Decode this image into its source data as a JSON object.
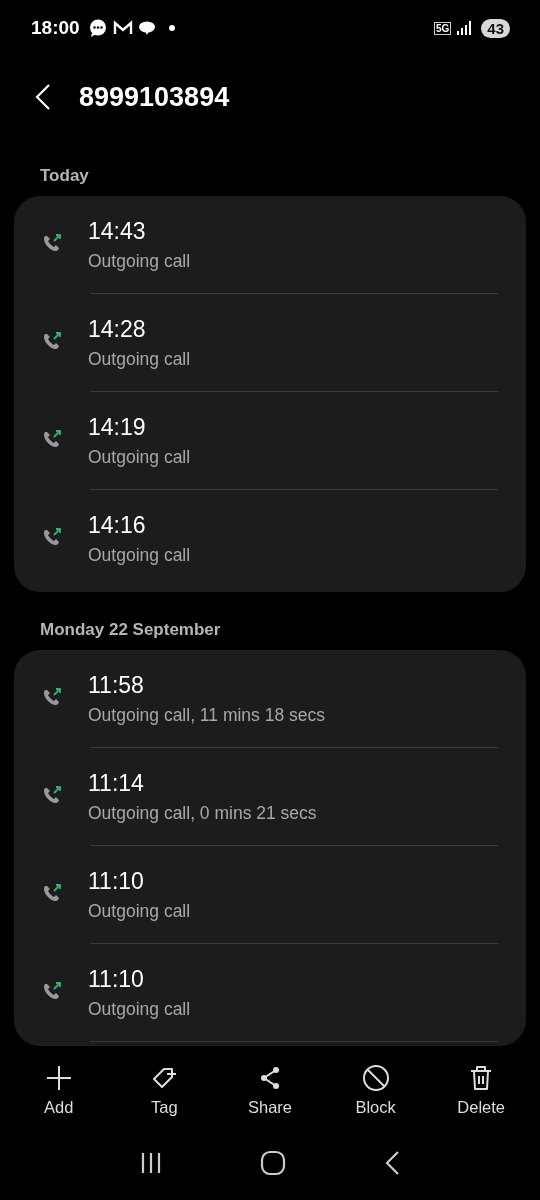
{
  "status_bar": {
    "time": "18:00",
    "network": "5G",
    "battery": "43"
  },
  "header": {
    "title": "8999103894"
  },
  "groups": [
    {
      "label": "Today",
      "continues": false,
      "calls": [
        {
          "time": "14:43",
          "detail": "Outgoing call",
          "kind": "outgoing"
        },
        {
          "time": "14:28",
          "detail": "Outgoing call",
          "kind": "outgoing"
        },
        {
          "time": "14:19",
          "detail": "Outgoing call",
          "kind": "outgoing"
        },
        {
          "time": "14:16",
          "detail": "Outgoing call",
          "kind": "outgoing"
        }
      ]
    },
    {
      "label": "Monday 22 September",
      "continues": true,
      "calls": [
        {
          "time": "11:58",
          "detail": "Outgoing call, 11 mins 18 secs",
          "kind": "outgoing"
        },
        {
          "time": "11:14",
          "detail": "Outgoing call, 0 mins 21 secs",
          "kind": "outgoing"
        },
        {
          "time": "11:10",
          "detail": "Outgoing call",
          "kind": "outgoing"
        },
        {
          "time": "11:10",
          "detail": "Outgoing call",
          "kind": "outgoing"
        }
      ]
    }
  ],
  "toolbar": [
    {
      "label": "Add",
      "kind": "add"
    },
    {
      "label": "Tag",
      "kind": "tag"
    },
    {
      "label": "Share",
      "kind": "share"
    },
    {
      "label": "Block",
      "kind": "block"
    },
    {
      "label": "Delete",
      "kind": "delete"
    }
  ]
}
